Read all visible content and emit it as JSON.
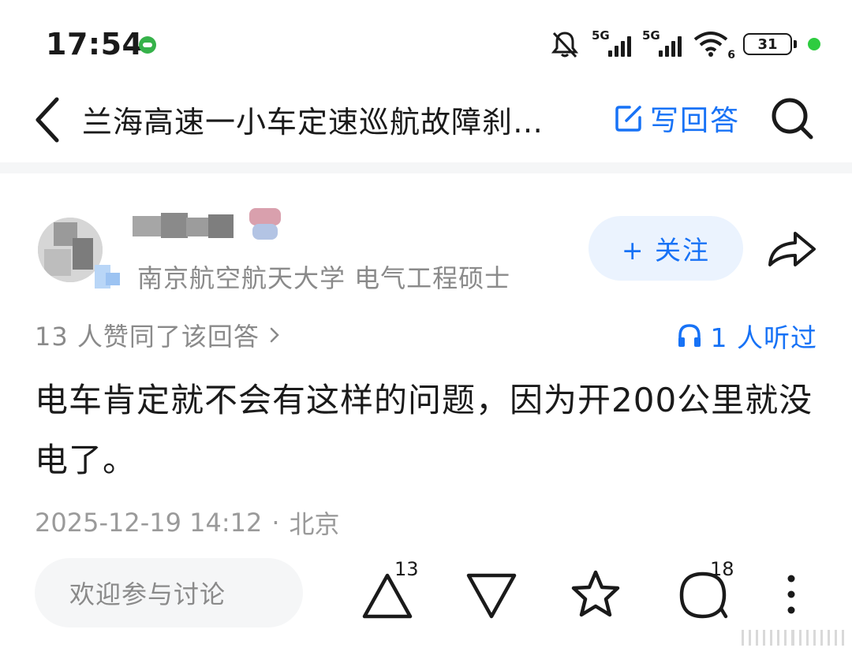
{
  "status_bar": {
    "time": "17:54",
    "network1": "5G",
    "network2": "5G",
    "wifi_sub": "6",
    "battery": "31",
    "icons": [
      "app-notification-icon",
      "mute-bell-icon",
      "signal-icon",
      "wifi-icon",
      "battery-icon"
    ]
  },
  "header": {
    "title": "兰海高速一小车定速巡航故障刹…",
    "write_answer_label": "写回答",
    "icons": [
      "back-arrow-icon",
      "edit-icon",
      "search-icon"
    ]
  },
  "author": {
    "credential": "南京航空航天大学 电气工程硕士",
    "follow_label": "+ 关注",
    "icons": [
      "share-icon",
      "verified-icon"
    ]
  },
  "stats": {
    "upvote_text": "13 人赞同了该回答",
    "listen_text": "1 人听过"
  },
  "answer": {
    "content": "电车肯定就不会有这样的问题，因为开200公里就没电了。",
    "date": "2025-12-19 14:12",
    "separator": "·",
    "location": "北京"
  },
  "bottom_bar": {
    "comment_placeholder": "欢迎参与讨论",
    "upvote_count": "13",
    "comment_count": "18",
    "icons": [
      "upvote-icon",
      "downvote-icon",
      "favorite-star-icon",
      "comment-icon",
      "more-icon"
    ]
  },
  "colors": {
    "accent": "#1772f6",
    "follow_bg": "#ebf3fe",
    "muted_text": "#8a8a8a",
    "divider": "#f5f6f7",
    "charge": "#2ecc40"
  }
}
